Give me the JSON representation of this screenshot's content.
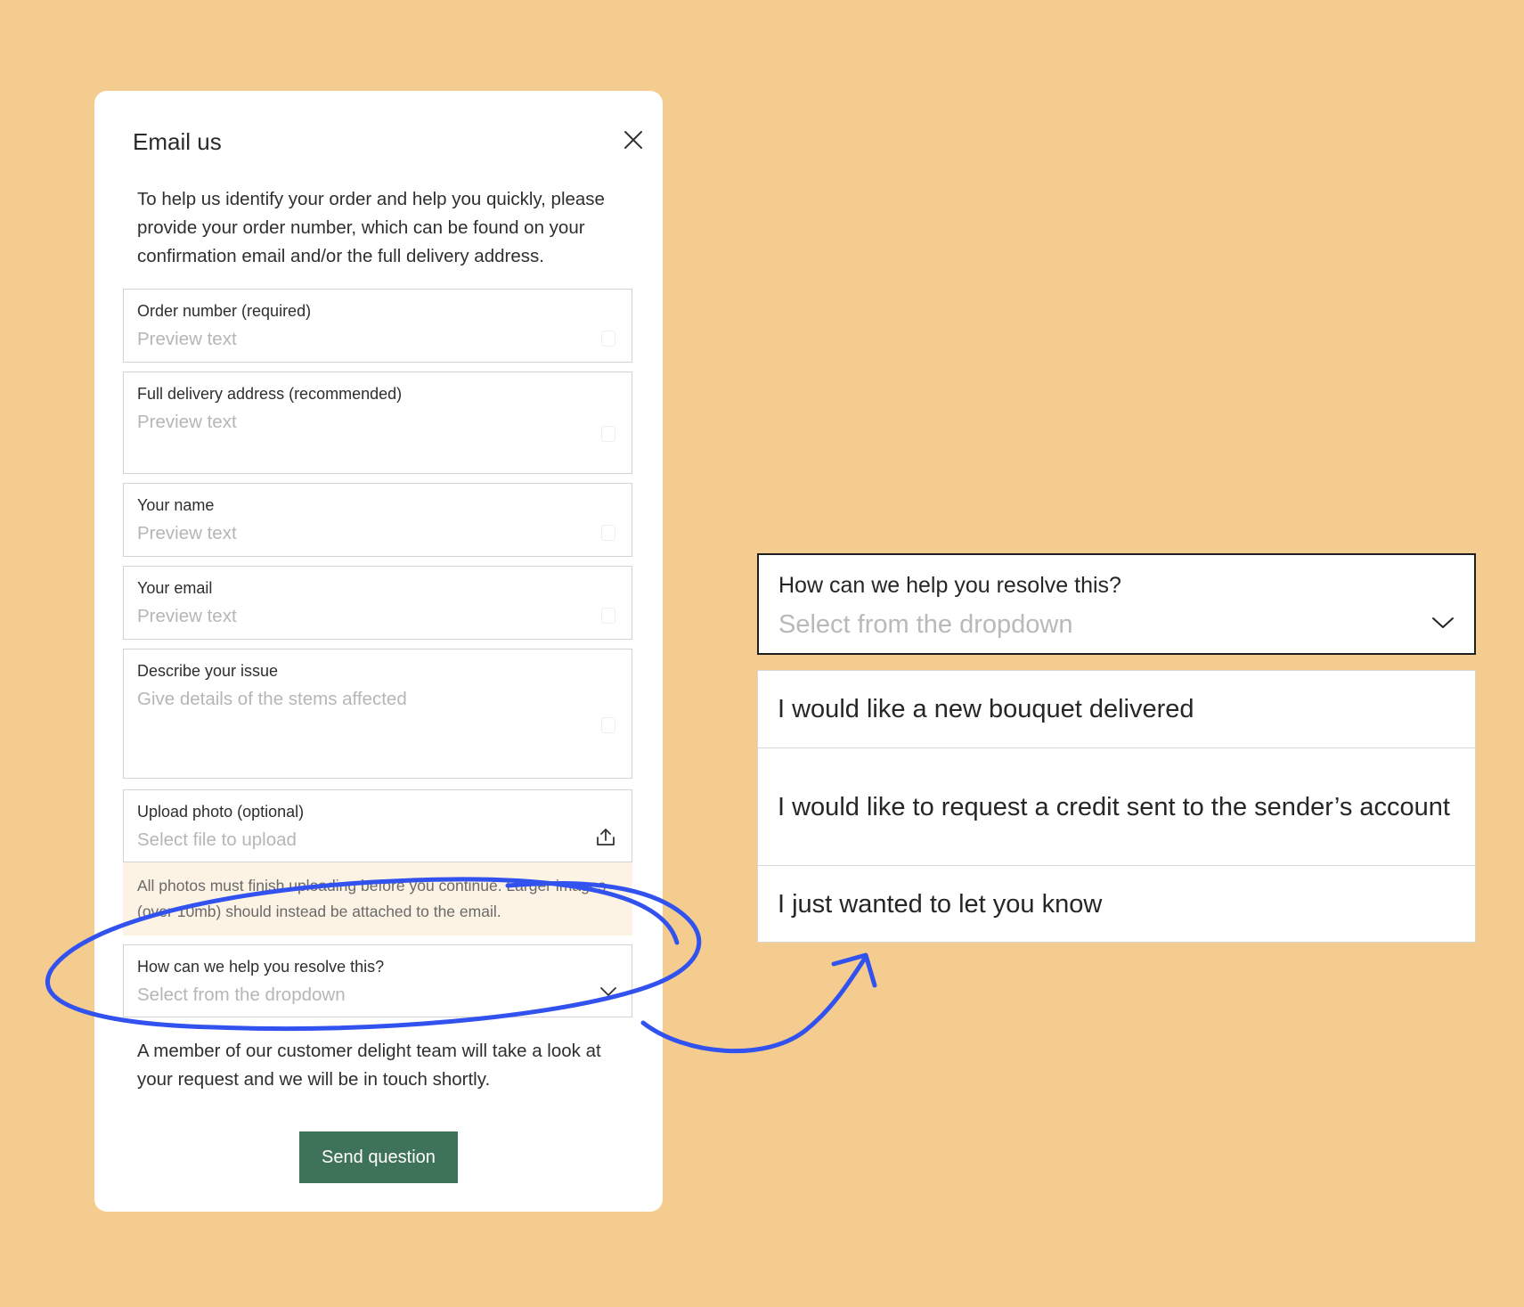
{
  "modal": {
    "title": "Email us",
    "intro": "To help us identify your order and help you quickly, please provide your order number, which can be found on your confirmation email and/or the full delivery address.",
    "fields": {
      "order_number": {
        "label": "Order number (required)",
        "placeholder": "Preview text"
      },
      "delivery_address": {
        "label": "Full delivery address (recommended)",
        "placeholder": "Preview text"
      },
      "name": {
        "label": "Your name",
        "placeholder": "Preview text"
      },
      "email": {
        "label": "Your email",
        "placeholder": "Preview text"
      },
      "issue": {
        "label": "Describe your issue",
        "placeholder": "Give details of the stems affected"
      },
      "upload": {
        "label": "Upload photo (optional)",
        "placeholder": "Select file to upload"
      },
      "resolve": {
        "label": "How can we help you resolve this?",
        "placeholder": "Select from the dropdown"
      }
    },
    "upload_notice": "All photos must finish uploading before you continue. Larger images (over 10mb) should instead be attached to the email.",
    "footer_text": "A member of our customer delight team will take a look at your request and we will be in touch shortly.",
    "send_label": "Send question"
  },
  "expanded_dropdown": {
    "label": "How can we help you resolve this?",
    "placeholder": "Select from the dropdown",
    "options": [
      "I would like a new bouquet delivered",
      "I would like to request a credit sent to the sender’s account",
      "I just wanted to let you know"
    ]
  },
  "colors": {
    "background": "#f4cc90",
    "button": "#3f7359",
    "annotation": "#3252f0",
    "notice_bg": "#fdf3e5"
  },
  "icons": [
    "close-icon",
    "upload-icon",
    "chevron-down-icon",
    "annotation-arrow"
  ]
}
